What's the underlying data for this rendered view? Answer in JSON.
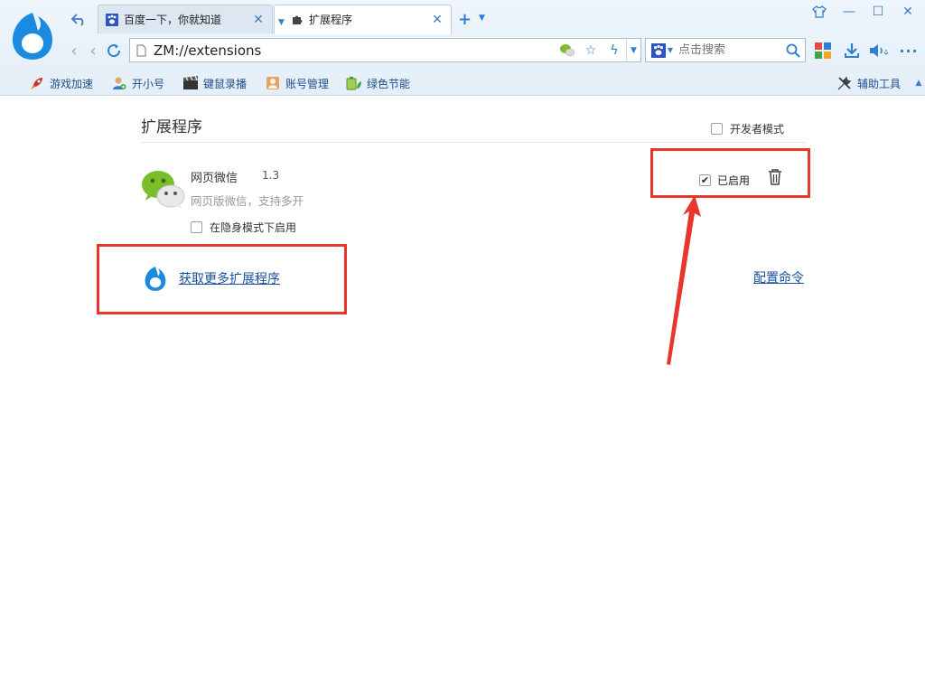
{
  "browser": {
    "tabs": [
      {
        "title": "百度一下，你就知道",
        "active": false
      },
      {
        "title": "扩展程序",
        "active": true
      }
    ],
    "address": {
      "url": "ZM://extensions"
    },
    "search": {
      "placeholder": "点击搜索"
    },
    "favorites": [
      {
        "label": "游戏加速",
        "icon": "rocket-icon"
      },
      {
        "label": "开小号",
        "icon": "user-add-icon"
      },
      {
        "label": "键鼠录播",
        "icon": "film-clapper-icon"
      },
      {
        "label": "账号管理",
        "icon": "account-card-icon"
      },
      {
        "label": "绿色节能",
        "icon": "battery-leaf-icon"
      }
    ],
    "tools_label": "辅助工具"
  },
  "page": {
    "title": "扩展程序",
    "developer_mode_label": "开发者模式",
    "extensions": [
      {
        "name": "网页微信",
        "version": "1.3",
        "description": "网页版微信，支持多开",
        "incognito_label": "在隐身模式下启用",
        "incognito_checked": false,
        "enabled_label": "已启用",
        "enabled": true
      }
    ],
    "get_more_label": "获取更多扩展程序",
    "configure_commands_label": "配置命令"
  },
  "colors": {
    "accent": "#2f7fd1",
    "link": "#1a4f9c",
    "annotation_red": "#e8362e",
    "wechat_green": "#7bbd2a"
  }
}
